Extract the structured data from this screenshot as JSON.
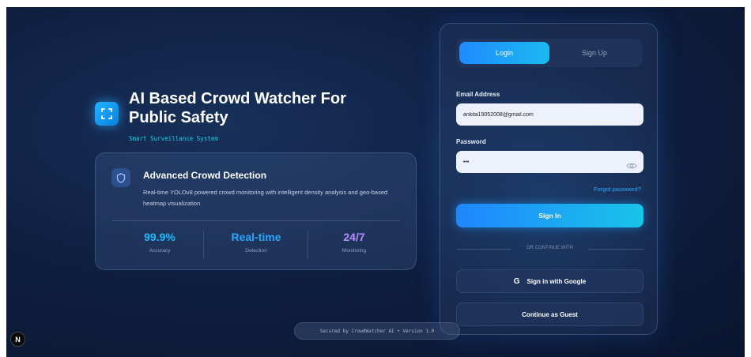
{
  "hero": {
    "logo_icon": "scan-frame-icon",
    "title": "AI Based Crowd Watcher For Public Safety",
    "subtitle": "Smart Surveillance System"
  },
  "feature": {
    "icon": "shield-icon",
    "title": "Advanced Crowd Detection",
    "description": "Real-time YOLOv8 powered crowd monitoring with intelligent density analysis and geo-based heatmap visualization",
    "stats": [
      {
        "value": "99.9%",
        "label": "Accuracy",
        "color": "#22b8ff"
      },
      {
        "value": "Real-time",
        "label": "Detection",
        "color": "#2ba6ff"
      },
      {
        "value": "24/7",
        "label": "Monitoring",
        "color": "#b48cff"
      }
    ]
  },
  "auth": {
    "tabs": {
      "login": "Login",
      "signup": "Sign Up"
    },
    "email_label": "Email Address",
    "email_value": "ankita19052008@gmail.com",
    "password_label": "Password",
    "password_value": "•••",
    "forgot": "Forgot password?",
    "signin": "Sign In",
    "divider": "OR CONTINUE WITH",
    "google_glyph": "G",
    "google": "Sign in with Google",
    "guest": "Continue as Guest"
  },
  "footer": {
    "text": "Secured by CrowdWatcher AI • Version 1.0",
    "badge": "N"
  },
  "colors": {
    "accent": "#1e8bff",
    "cyan": "#1fd0e6",
    "background": "#0f1f40"
  }
}
